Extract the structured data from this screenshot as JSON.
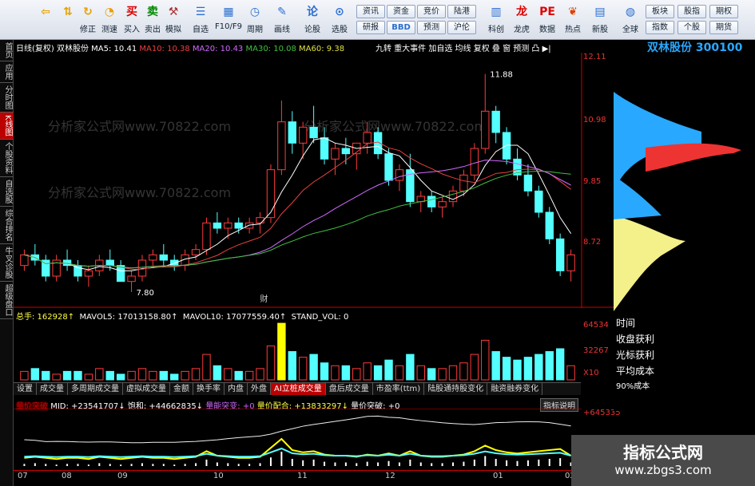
{
  "toolbar": {
    "buttons": [
      {
        "label": "",
        "icon": "back-arrow-icon"
      },
      {
        "label": "",
        "icon": "updown-arrow-icon"
      },
      {
        "label": "修正",
        "icon": "refresh-icon"
      },
      {
        "label": "测速",
        "icon": "gauge-icon"
      },
      {
        "label": "买入",
        "icon": "buy-icon"
      },
      {
        "label": "卖出",
        "icon": "sell-icon"
      },
      {
        "label": "模拟",
        "icon": "hammer-icon"
      },
      {
        "label": "自选",
        "icon": "watchlist-icon"
      },
      {
        "label": "F10/F9",
        "icon": "f10-icon"
      },
      {
        "label": "周期",
        "icon": "clock-icon"
      },
      {
        "label": "画线",
        "icon": "pen-icon"
      },
      {
        "label": "论股",
        "icon": "discuss-icon"
      },
      {
        "label": "选股",
        "icon": "chart-search-icon"
      }
    ],
    "grid_buttons": [
      [
        "资讯",
        "资金",
        "竞价",
        "陆港"
      ],
      [
        "研报",
        "BBD",
        "预测",
        "沪伦"
      ]
    ],
    "right_buttons": [
      {
        "label": "科创",
        "icon": "kechuang-icon"
      },
      {
        "label": "龙虎",
        "icon": "dragon-icon"
      },
      {
        "label": "数据",
        "icon": "data-icon"
      },
      {
        "label": "热点",
        "icon": "fire-icon"
      },
      {
        "label": "新股",
        "icon": "newstock-icon"
      },
      {
        "label": "全球",
        "icon": "globe-icon"
      }
    ],
    "far_right": [
      [
        "板块",
        "股指",
        "期权"
      ],
      [
        "指数",
        "个股",
        "期货"
      ]
    ]
  },
  "leftnav": [
    "首页",
    "应用",
    "分时图",
    "K线图",
    "个股资料",
    "自选股",
    "综合排名",
    "牛叉诊股",
    "超级盘口"
  ],
  "main": {
    "title": "日线(复权)  双林股份",
    "ma": [
      {
        "label": "MA5: 10.41",
        "color": "#ffffff"
      },
      {
        "label": "MA10: 10.38",
        "color": "#e84040"
      },
      {
        "label": "MA20: 10.43",
        "color": "#d06aff"
      },
      {
        "label": "MA30: 10.08",
        "color": "#40c040"
      },
      {
        "label": "MA60: 9.38",
        "color": "#e0e040"
      }
    ],
    "tools": "九转  重大事件  加自选  均线  复权  叠  窗  预测  凸  ▶|",
    "y_ticks": [
      "12.11",
      "10.98",
      "9.85",
      "8.72"
    ],
    "high_label": "11.88",
    "low_label": "7.80",
    "event_label": "财",
    "candles": [
      [
        8.3,
        8.6,
        8.2,
        8.5
      ],
      [
        8.5,
        8.7,
        8.3,
        8.4
      ],
      [
        8.4,
        8.5,
        8.0,
        8.1
      ],
      [
        8.1,
        8.5,
        8.0,
        8.4
      ],
      [
        8.4,
        8.6,
        8.2,
        8.3
      ],
      [
        8.3,
        8.4,
        8.0,
        8.1
      ],
      [
        8.1,
        8.3,
        7.9,
        8.2
      ],
      [
        8.2,
        8.5,
        8.1,
        8.4
      ],
      [
        8.4,
        8.6,
        8.2,
        8.3
      ],
      [
        8.3,
        8.4,
        8.0,
        8.0
      ],
      [
        8.0,
        8.2,
        7.8,
        8.1
      ],
      [
        8.1,
        8.5,
        8.0,
        8.4
      ],
      [
        8.4,
        8.6,
        8.3,
        8.5
      ],
      [
        8.5,
        8.7,
        8.3,
        8.4
      ],
      [
        8.4,
        8.5,
        8.2,
        8.3
      ],
      [
        8.3,
        8.6,
        8.2,
        8.5
      ],
      [
        8.5,
        8.7,
        8.4,
        8.6
      ],
      [
        8.6,
        9.2,
        8.5,
        9.1
      ],
      [
        9.1,
        9.3,
        8.9,
        9.0
      ],
      [
        9.0,
        9.2,
        8.8,
        9.1
      ],
      [
        9.1,
        9.2,
        8.9,
        9.0
      ],
      [
        9.0,
        9.2,
        8.9,
        9.1
      ],
      [
        9.1,
        9.3,
        8.9,
        9.2
      ],
      [
        9.2,
        10.2,
        9.1,
        10.1
      ],
      [
        10.1,
        11.4,
        10.0,
        11.0
      ],
      [
        11.0,
        11.2,
        10.4,
        10.6
      ],
      [
        10.6,
        11.0,
        10.3,
        10.9
      ],
      [
        10.9,
        11.3,
        10.6,
        10.7
      ],
      [
        10.7,
        10.9,
        10.2,
        10.3
      ],
      [
        10.3,
        10.6,
        10.0,
        10.5
      ],
      [
        10.5,
        10.7,
        10.2,
        10.4
      ],
      [
        10.4,
        10.6,
        10.1,
        10.6
      ],
      [
        10.6,
        11.0,
        10.4,
        10.8
      ],
      [
        10.8,
        10.9,
        10.3,
        10.4
      ],
      [
        10.4,
        10.5,
        9.8,
        9.9
      ],
      [
        9.9,
        10.2,
        9.7,
        10.1
      ],
      [
        10.1,
        10.4,
        9.4,
        9.5
      ],
      [
        9.5,
        9.7,
        9.3,
        9.6
      ],
      [
        9.6,
        9.7,
        9.3,
        9.4
      ],
      [
        9.4,
        9.6,
        9.2,
        9.5
      ],
      [
        9.5,
        9.8,
        9.4,
        9.7
      ],
      [
        9.7,
        10.1,
        9.6,
        10.0
      ],
      [
        10.0,
        10.6,
        9.9,
        10.5
      ],
      [
        10.5,
        11.9,
        10.4,
        11.2
      ],
      [
        11.2,
        11.3,
        10.6,
        10.8
      ],
      [
        10.8,
        10.9,
        10.2,
        10.3
      ],
      [
        10.3,
        10.5,
        9.9,
        10.0
      ],
      [
        10.0,
        10.2,
        9.6,
        9.7
      ],
      [
        9.7,
        9.8,
        9.2,
        9.3
      ],
      [
        9.3,
        9.4,
        8.7,
        8.8
      ],
      [
        8.8,
        8.9,
        8.1,
        8.2
      ],
      [
        8.2,
        8.6,
        8.0,
        8.5
      ]
    ],
    "vol_header": {
      "zong": "总手: 162928↑",
      "mavol5": "MAVOL5: 17013158.80↑",
      "mavol10": "MAVOL10: 17077559.40↑",
      "stand": "STAND_VOL: 0"
    },
    "vol_ticks": [
      "64534",
      "32267",
      "X10"
    ],
    "volumes": [
      3,
      4,
      3,
      2,
      3,
      3,
      2,
      4,
      3,
      2,
      3,
      4,
      3,
      3,
      2,
      3,
      4,
      9,
      5,
      4,
      3,
      3,
      4,
      12,
      20,
      10,
      8,
      9,
      6,
      5,
      5,
      4,
      6,
      5,
      7,
      5,
      9,
      5,
      4,
      4,
      5,
      6,
      9,
      14,
      10,
      8,
      7,
      8,
      9,
      10,
      11,
      5
    ]
  },
  "tabs": [
    "设置",
    "成交量",
    "多周期成交量",
    "虚拟成交量",
    "金额",
    "换手率",
    "内盘",
    "外盘",
    "AI立桩成交量",
    "盘后成交量",
    "市盈率(ttm)",
    "陆股通持股变化",
    "融资融券变化"
  ],
  "tabs_active": 8,
  "indicator": {
    "name": "量价突破",
    "mid": "MID: +23541707↓",
    "baohe": "饱和: +44662835↓",
    "lianglv": "量能突变: +0",
    "liangjia": "量价配合: +13833297↓",
    "tupo": "量价突破: +0",
    "help": "指标说明",
    "right_val": "+645335"
  },
  "xaxis": [
    "07",
    "08",
    "09",
    "10",
    "11",
    "12",
    "01",
    "02"
  ],
  "stock": {
    "name": "双林股份",
    "code": "300100"
  },
  "right_panel": [
    "时间",
    "收盘获利",
    "光标获利",
    "平均成本",
    "90%成本"
  ],
  "watermark": {
    "title": "指标公式网",
    "url": "www.zbgs3.com"
  },
  "faint_text": "分析家公式网www.70822.com"
}
